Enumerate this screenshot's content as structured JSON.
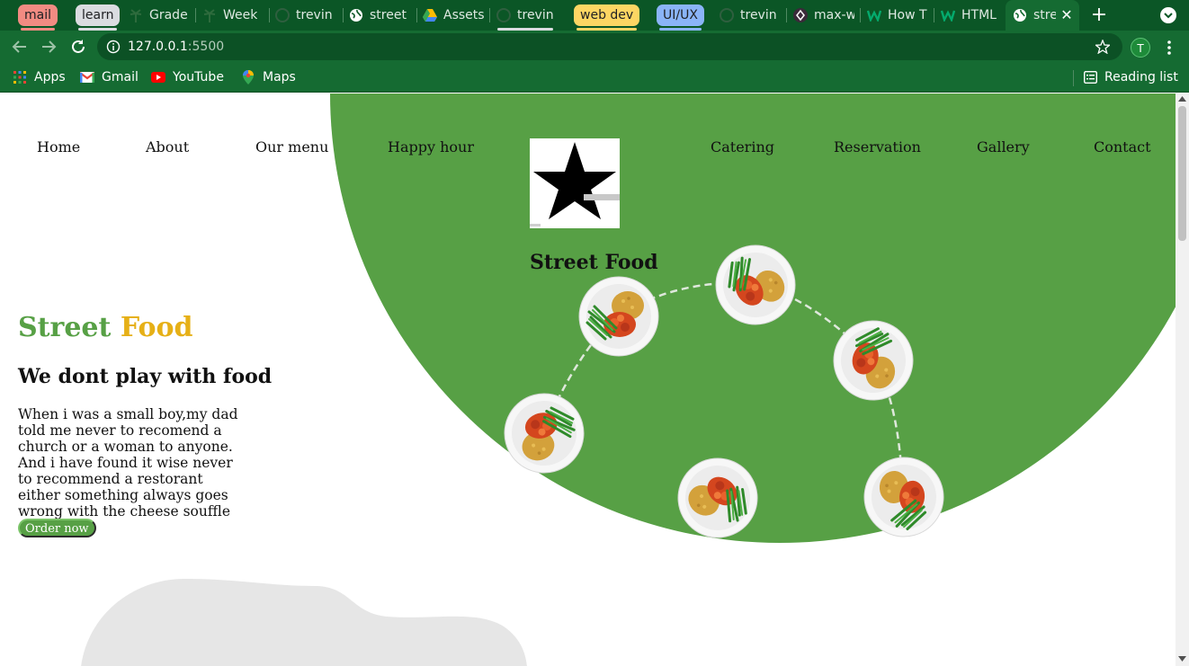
{
  "browser": {
    "tabs": [
      {
        "label": "mail",
        "type": "group",
        "color": "#f28b82"
      },
      {
        "label": "learn",
        "type": "group",
        "color": "#dadce0"
      },
      {
        "label": "Grade",
        "icon": "palm-icon"
      },
      {
        "label": "Week",
        "icon": "palm-icon"
      },
      {
        "label": "trevin",
        "icon": "github-icon"
      },
      {
        "label": "street",
        "icon": "globe-icon"
      },
      {
        "label": "Assets",
        "icon": "drive-icon"
      },
      {
        "label": "trevin",
        "icon": "github-icon"
      },
      {
        "label": "web dev",
        "type": "group",
        "color": "#fdd663"
      },
      {
        "label": "UI/UX",
        "type": "group",
        "color": "#8ab4f8"
      },
      {
        "label": "trevin",
        "icon": "github-icon"
      },
      {
        "label": "max-w",
        "icon": "diamond-icon"
      },
      {
        "label": "How T",
        "icon": "w3-icon"
      },
      {
        "label": "HTML",
        "icon": "w3-icon"
      },
      {
        "label": "stre",
        "icon": "globe-icon",
        "active": true
      }
    ],
    "url_host": "127.0.0.1",
    "url_port": ":5500",
    "profile_initial": "T",
    "bookmarks": [
      {
        "label": "Apps",
        "icon": "apps-grid-icon"
      },
      {
        "label": "Gmail",
        "icon": "gmail-icon"
      },
      {
        "label": "YouTube",
        "icon": "youtube-icon"
      },
      {
        "label": "Maps",
        "icon": "maps-icon"
      }
    ],
    "reading_list": "Reading list"
  },
  "site": {
    "nav_left": [
      "Home",
      "About",
      "Our menu",
      "Happy hour"
    ],
    "nav_right": [
      "Catering",
      "Reservation",
      "Gallery",
      "Contact"
    ],
    "logo_title": "Street Food",
    "hero": {
      "title_word1": "Street",
      "title_word2": "Food",
      "subtitle": "We dont play with food",
      "text": "When i was a small boy,my dad told me never to recomend a church or a woman to anyone. And i have found it wise never to recommend a restorant either something always goes wrong with the cheese souffle",
      "button": "Order now"
    },
    "colors": {
      "green": "#57a045",
      "gold": "#e6b017",
      "blob_gray": "#e6e6e6"
    }
  }
}
